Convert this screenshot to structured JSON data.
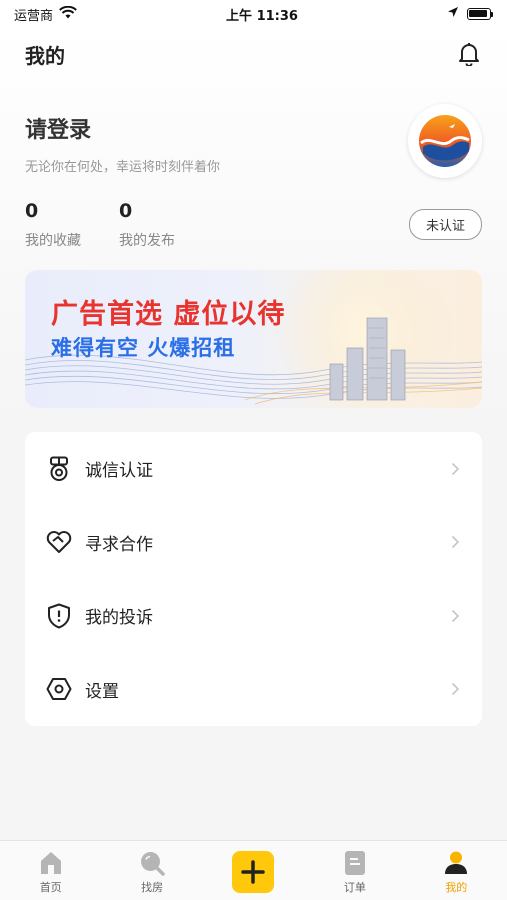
{
  "status_bar": {
    "carrier": "运营商",
    "time": "上午 11:36"
  },
  "header": {
    "title": "我的"
  },
  "profile": {
    "login_text": "请登录",
    "slogan": "无论你在何处，幸运将时刻伴着你",
    "favorites_count": "0",
    "favorites_label": "我的收藏",
    "posts_count": "0",
    "posts_label": "我的发布",
    "verify_label": "未认证"
  },
  "banner": {
    "line1": "广告首选 虚位以待",
    "line2": "难得有空 火爆招租"
  },
  "menu": {
    "items": [
      {
        "label": "诚信认证",
        "icon": "medal-icon"
      },
      {
        "label": "寻求合作",
        "icon": "handshake-heart-icon"
      },
      {
        "label": "我的投诉",
        "icon": "shield-alert-icon"
      },
      {
        "label": "设置",
        "icon": "hexagon-settings-icon"
      }
    ]
  },
  "tabs": [
    {
      "label": "首页",
      "icon": "home-icon"
    },
    {
      "label": "找房",
      "icon": "search-icon"
    },
    {
      "label": "",
      "icon": "plus-icon"
    },
    {
      "label": "订单",
      "icon": "order-icon"
    },
    {
      "label": "我的",
      "icon": "user-icon"
    }
  ],
  "colors": {
    "accent": "#ffc80b",
    "active_tab": "#f1a100",
    "banner_red": "#e8332e",
    "banner_blue": "#2b6fe8"
  }
}
